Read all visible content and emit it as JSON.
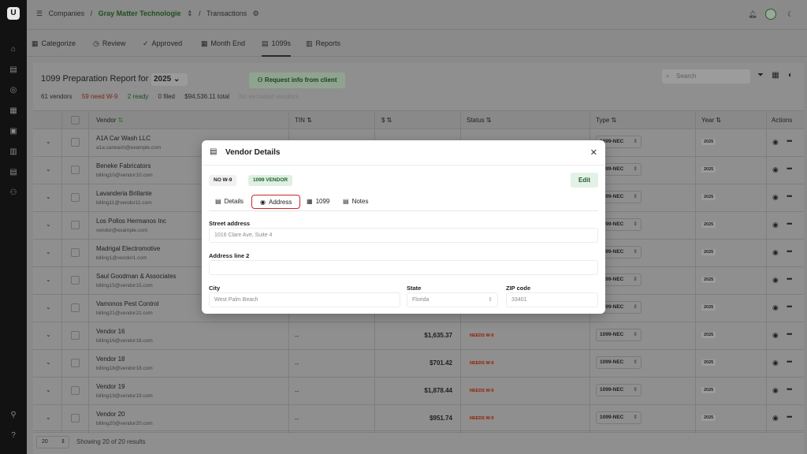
{
  "breadcrumb": {
    "root": "Companies",
    "company": "Gray Matter Technologie",
    "page": "Transactions"
  },
  "nav_tabs": [
    {
      "label": "Categorize",
      "icon": "categorize-icon"
    },
    {
      "label": "Review",
      "icon": "review-icon"
    },
    {
      "label": "Approved",
      "icon": "check-circle-icon"
    },
    {
      "label": "Month End",
      "icon": "calendar-icon"
    },
    {
      "label": "1099s",
      "icon": "document-icon",
      "active": true
    },
    {
      "label": "Reports",
      "icon": "bar-chart-icon"
    }
  ],
  "report": {
    "title": "1099 Preparation Report for",
    "year": "2025",
    "request_button": "Request info from client",
    "stats": {
      "vendors": "61 vendors",
      "need_w9": "59 need W-9",
      "ready": "2 ready",
      "filed": "0 filed",
      "total": "$94,536.11 total",
      "excluded": "No excluded vendors"
    },
    "search_placeholder": "Search"
  },
  "columns": {
    "vendor": "Vendor",
    "tin": "TIN",
    "amount": "$",
    "status": "Status",
    "type": "Type",
    "year": "Year",
    "actions": "Actions"
  },
  "rows": [
    {
      "name": "A1A Car Wash LLC",
      "email": "a1a.carwash@example.com",
      "tin": "",
      "amount": "",
      "status": "",
      "type": "1099-NEC",
      "year": "2025"
    },
    {
      "name": "Beneke Fabricators",
      "email": "billing10@vendor10.com",
      "tin": "",
      "amount": "",
      "status": "",
      "type": "1099-NEC",
      "year": "2025"
    },
    {
      "name": "Lavanderia Brillante",
      "email": "billing11@vendor11.com",
      "tin": "",
      "amount": "",
      "status": "",
      "type": "1099-NEC",
      "year": "2025"
    },
    {
      "name": "Los Pollos Hermanos Inc",
      "email": "vendor@example.com",
      "tin": "",
      "amount": "",
      "status": "",
      "type": "1099-NEC",
      "year": "2025"
    },
    {
      "name": "Madrigal Electromotive",
      "email": "billing1@vendor1.com",
      "tin": "",
      "amount": "",
      "status": "",
      "type": "1099-NEC",
      "year": "2025"
    },
    {
      "name": "Saul Goodman & Associates",
      "email": "billing15@vendor15.com",
      "tin": "",
      "amount": "",
      "status": "",
      "type": "1099-NEC",
      "year": "2025"
    },
    {
      "name": "Vamonos Pest Control",
      "email": "billing21@vendor21.com",
      "tin": "",
      "amount": "",
      "status": "",
      "type": "1099-NEC",
      "year": "2025"
    },
    {
      "name": "Vendor 16",
      "email": "billing16@vendor16.com",
      "tin": "--",
      "amount": "$1,635.37",
      "status": "NEEDS W-9",
      "type": "1099-NEC",
      "year": "2025"
    },
    {
      "name": "Vendor 18",
      "email": "billing18@vendor18.com",
      "tin": "--",
      "amount": "$701.42",
      "status": "NEEDS W-9",
      "type": "1099-NEC",
      "year": "2025"
    },
    {
      "name": "Vendor 19",
      "email": "billing19@vendor19.com",
      "tin": "--",
      "amount": "$1,878.44",
      "status": "NEEDS W-9",
      "type": "1099-NEC",
      "year": "2025"
    },
    {
      "name": "Vendor 20",
      "email": "billing20@vendor20.com",
      "tin": "--",
      "amount": "$951.74",
      "status": "NEEDS W-9",
      "type": "1099-NEC",
      "year": "2025"
    }
  ],
  "pagination": {
    "page_size": "20",
    "results": "Showing 20 of 20 results"
  },
  "modal": {
    "title": "Vendor Details",
    "badges": [
      "NO W-9",
      "1099 VENDOR"
    ],
    "edit_label": "Edit",
    "tabs": [
      "Details",
      "Address",
      "1099",
      "Notes"
    ],
    "active_tab": "Address",
    "fields": {
      "street_label": "Street address",
      "street_value": "1016 Clare Ave, Suite 4",
      "line2_label": "Address line 2",
      "line2_value": "",
      "city_label": "City",
      "city_value": "West Palm Beach",
      "state_label": "State",
      "state_value": "Florida",
      "zip_label": "ZIP code",
      "zip_value": "33401"
    }
  }
}
